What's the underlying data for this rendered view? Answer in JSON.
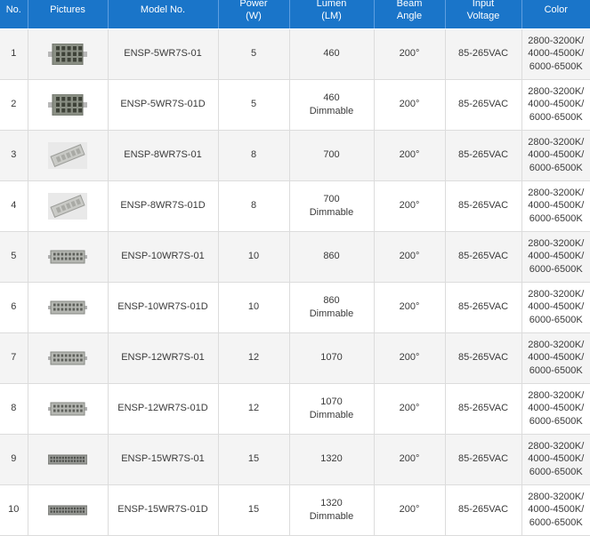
{
  "headers": {
    "no": "No.",
    "pictures": "Pictures",
    "model": "Model No.",
    "power": [
      "Power",
      "(W)"
    ],
    "lumen": [
      "Lumen",
      "(LM)"
    ],
    "beam": [
      "Beam",
      "Angle"
    ],
    "voltage": [
      "Input",
      "Voltage"
    ],
    "color": "Color"
  },
  "rows": [
    {
      "no": "1",
      "image": "r7s-5w-lamp-photo",
      "model": "ENSP-5WR7S-01",
      "power": "5",
      "lumen": "460",
      "dimmable": "",
      "beam": "200°",
      "voltage": "85-265VAC",
      "color": [
        "2800-3200K/",
        "4000-4500K/",
        "6000-6500K"
      ]
    },
    {
      "no": "2",
      "image": "r7s-5w-lamp-photo",
      "model": "ENSP-5WR7S-01D",
      "power": "5",
      "lumen": "460",
      "dimmable": "Dimmable",
      "beam": "200°",
      "voltage": "85-265VAC",
      "color": [
        "2800-3200K/",
        "4000-4500K/",
        "6000-6500K"
      ]
    },
    {
      "no": "3",
      "image": "r7s-8w-lamp-photo",
      "model": "ENSP-8WR7S-01",
      "power": "8",
      "lumen": "700",
      "dimmable": "",
      "beam": "200°",
      "voltage": "85-265VAC",
      "color": [
        "2800-3200K/",
        "4000-4500K/",
        "6000-6500K"
      ]
    },
    {
      "no": "4",
      "image": "r7s-8w-lamp-photo",
      "model": "ENSP-8WR7S-01D",
      "power": "8",
      "lumen": "700",
      "dimmable": "Dimmable",
      "beam": "200°",
      "voltage": "85-265VAC",
      "color": [
        "2800-3200K/",
        "4000-4500K/",
        "6000-6500K"
      ]
    },
    {
      "no": "5",
      "image": "r7s-10w-lamp-photo",
      "model": "ENSP-10WR7S-01",
      "power": "10",
      "lumen": "860",
      "dimmable": "",
      "beam": "200°",
      "voltage": "85-265VAC",
      "color": [
        "2800-3200K/",
        "4000-4500K/",
        "6000-6500K"
      ]
    },
    {
      "no": "6",
      "image": "r7s-10w-lamp-photo",
      "model": "ENSP-10WR7S-01D",
      "power": "10",
      "lumen": "860",
      "dimmable": "Dimmable",
      "beam": "200°",
      "voltage": "85-265VAC",
      "color": [
        "2800-3200K/",
        "4000-4500K/",
        "6000-6500K"
      ]
    },
    {
      "no": "7",
      "image": "r7s-12w-lamp-photo",
      "model": "ENSP-12WR7S-01",
      "power": "12",
      "lumen": "1070",
      "dimmable": "",
      "beam": "200°",
      "voltage": "85-265VAC",
      "color": [
        "2800-3200K/",
        "4000-4500K/",
        "6000-6500K"
      ]
    },
    {
      "no": "8",
      "image": "r7s-12w-lamp-photo",
      "model": "ENSP-12WR7S-01D",
      "power": "12",
      "lumen": "1070",
      "dimmable": "Dimmable",
      "beam": "200°",
      "voltage": "85-265VAC",
      "color": [
        "2800-3200K/",
        "4000-4500K/",
        "6000-6500K"
      ]
    },
    {
      "no": "9",
      "image": "r7s-15w-lamp-photo",
      "model": "ENSP-15WR7S-01",
      "power": "15",
      "lumen": "1320",
      "dimmable": "",
      "beam": "200°",
      "voltage": "85-265VAC",
      "color": [
        "2800-3200K/",
        "4000-4500K/",
        "6000-6500K"
      ]
    },
    {
      "no": "10",
      "image": "r7s-15w-lamp-photo",
      "model": "ENSP-15WR7S-01D",
      "power": "15",
      "lumen": "1320",
      "dimmable": "Dimmable",
      "beam": "200°",
      "voltage": "85-265VAC",
      "color": [
        "2800-3200K/",
        "4000-4500K/",
        "6000-6500K"
      ]
    }
  ],
  "colors": {
    "header_bg": "#1a75c9",
    "header_text": "#ffffff",
    "row_alt_bg": "#f4f4f4",
    "grid_line": "#dcdcdc"
  }
}
